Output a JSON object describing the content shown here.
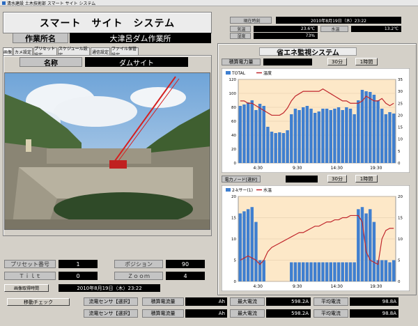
{
  "window": {
    "title": "清水建設 土木技術部  スマート サイト システム"
  },
  "header": {
    "system_title": "スマート　サイト　システム",
    "site_label": "作業所名",
    "site_value": "大津呂ダム作業所"
  },
  "status": {
    "time_label": "現在時刻",
    "time_value": "2010年8月19日（木）23:22",
    "temp_label": "気温",
    "temp_value": "23.6℃",
    "water_label": "水温",
    "water_value": "13.2℃",
    "humidity_label": "湿度",
    "humidity_value": "73%"
  },
  "tabs": [
    "画像",
    "カメ設定",
    "プリセット設定",
    "スケジュール設定",
    "通信設定",
    "ファイル保管設定"
  ],
  "camera": {
    "name_label": "名称",
    "name_value": "ダムサイト"
  },
  "controls": {
    "preset_label": "プリセット番号",
    "preset_value": "1",
    "position_label": "ポジション",
    "position_value": "90",
    "tilt_label": "Ｔｉｌｔ",
    "tilt_value": "0",
    "zoom_label": "Ｚｏｏｍ",
    "zoom_value": "4",
    "acq_button": "画像取得時間",
    "acq_value": "2010年8月19日（木）23:22"
  },
  "energy": {
    "title": "省エネ監視システム",
    "power_label": "積算電力量",
    "btn_30min": "30分",
    "btn_1hour": "1時間",
    "flow_label": "電力ノード[選択]",
    "btn2_30min": "30分",
    "btn2_1hour": "1時間"
  },
  "bottom": {
    "check_button": "移動チェック",
    "rows": [
      {
        "sensor": "流電センサ【選択】",
        "acc_label": "積算電流量",
        "acc_unit": "Ah",
        "max_label": "最大電流",
        "max_value": "598.2A",
        "avg_label": "平均電流",
        "avg_value": "98.8A"
      },
      {
        "sensor": "流電センサ【選択】",
        "acc_label": "積算電流量",
        "acc_unit": "Ah",
        "max_label": "最大電流",
        "max_value": "598.2A",
        "avg_label": "平均電流",
        "avg_value": "98.8A"
      }
    ]
  },
  "photo": {
    "icon": "dam-construction-site-photo"
  },
  "colors": {
    "bar": "#3f7fd0",
    "line": "#c0262c",
    "plot_bg": "#fde8c8"
  },
  "chart_data": [
    {
      "type": "bar",
      "legend": [
        "TOTAL",
        "温度"
      ],
      "x": [
        "4:30",
        "9:30",
        "14:30",
        "19:30"
      ],
      "ylim_left": [
        0,
        120
      ],
      "ylim_right": [
        0,
        35
      ],
      "left_ticks": [
        "0",
        "20",
        "40",
        "60",
        "80",
        "100",
        "120"
      ],
      "right_ticks": [
        "0",
        "5",
        "10",
        "15",
        "20",
        "25",
        "30",
        "35"
      ],
      "series": [
        {
          "name": "TOTAL",
          "values": [
            82,
            84,
            87,
            90,
            76,
            85,
            82,
            52,
            45,
            43,
            44,
            43,
            47,
            70,
            78,
            76,
            80,
            82,
            78,
            72,
            74,
            78,
            78,
            76,
            78,
            80,
            76,
            80,
            78,
            70,
            90,
            105,
            103,
            102,
            98,
            90,
            78,
            70,
            73,
            71
          ]
        },
        {
          "name": "温度",
          "values": [
            26,
            26,
            25,
            25,
            24,
            23,
            22,
            21,
            20,
            20,
            20,
            21,
            23,
            26,
            28,
            29,
            30,
            30,
            30,
            30,
            30,
            31,
            30,
            29,
            28,
            27,
            26,
            26,
            25,
            25,
            25,
            26,
            28,
            27,
            26,
            26,
            27,
            25,
            24,
            25
          ]
        }
      ]
    },
    {
      "type": "bar",
      "legend": [
        "2-kサー(1)",
        "水温"
      ],
      "x": [
        "4:30",
        "9:30",
        "14:30",
        "19:30"
      ],
      "ylim_left": [
        0,
        20
      ],
      "ylim_right": [
        0,
        20
      ],
      "left_ticks": [
        "0",
        "5",
        "10",
        "15",
        "20"
      ],
      "right_ticks": [
        "0",
        "5",
        "10",
        "15",
        "20"
      ],
      "series": [
        {
          "name": "2-kサー(1)",
          "values": [
            16,
            16.5,
            17,
            17.5,
            14,
            5,
            5,
            0,
            0,
            0,
            0,
            0,
            0,
            4.5,
            4.5,
            4.5,
            4.5,
            4.5,
            4.5,
            4.5,
            4.5,
            4.5,
            4.5,
            4.5,
            4.5,
            4.5,
            4.5,
            4.5,
            4.5,
            4.5,
            17,
            17.5,
            16,
            17,
            14,
            5,
            5,
            5,
            4.5,
            5
          ]
        },
        {
          "name": "水温",
          "values": [
            5,
            5.5,
            6,
            5.5,
            5,
            4,
            5,
            7,
            8,
            8.5,
            9,
            9.5,
            10,
            10.5,
            11,
            11.5,
            11.5,
            12,
            12.5,
            13,
            13,
            13.5,
            14,
            14,
            14.5,
            14.5,
            15,
            15,
            15.5,
            15.5,
            15.5,
            14,
            7,
            5,
            4.5,
            4,
            10,
            12,
            12.5,
            12.5
          ]
        }
      ]
    }
  ]
}
